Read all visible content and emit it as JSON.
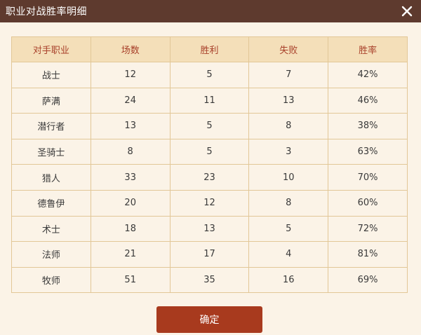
{
  "dialog": {
    "title": "职业对战胜率明细",
    "confirm_label": "确定"
  },
  "table": {
    "headers": [
      "对手职业",
      "场数",
      "胜利",
      "失败",
      "胜率"
    ],
    "rows": [
      [
        "战士",
        "12",
        "5",
        "7",
        "42%"
      ],
      [
        "萨满",
        "24",
        "11",
        "13",
        "46%"
      ],
      [
        "潜行者",
        "13",
        "5",
        "8",
        "38%"
      ],
      [
        "圣骑士",
        "8",
        "5",
        "3",
        "63%"
      ],
      [
        "猎人",
        "33",
        "23",
        "10",
        "70%"
      ],
      [
        "德鲁伊",
        "20",
        "12",
        "8",
        "60%"
      ],
      [
        "术士",
        "18",
        "13",
        "5",
        "72%"
      ],
      [
        "法师",
        "21",
        "17",
        "4",
        "81%"
      ],
      [
        "牧师",
        "51",
        "35",
        "16",
        "69%"
      ]
    ]
  },
  "colors": {
    "titlebar": "#5e3a2e",
    "header_bg": "#f4dfb9",
    "header_text": "#a8402a",
    "border": "#e2c797",
    "body_bg": "#fbf3e7",
    "button": "#a83a1e"
  },
  "icons": {
    "close": "close-icon"
  }
}
